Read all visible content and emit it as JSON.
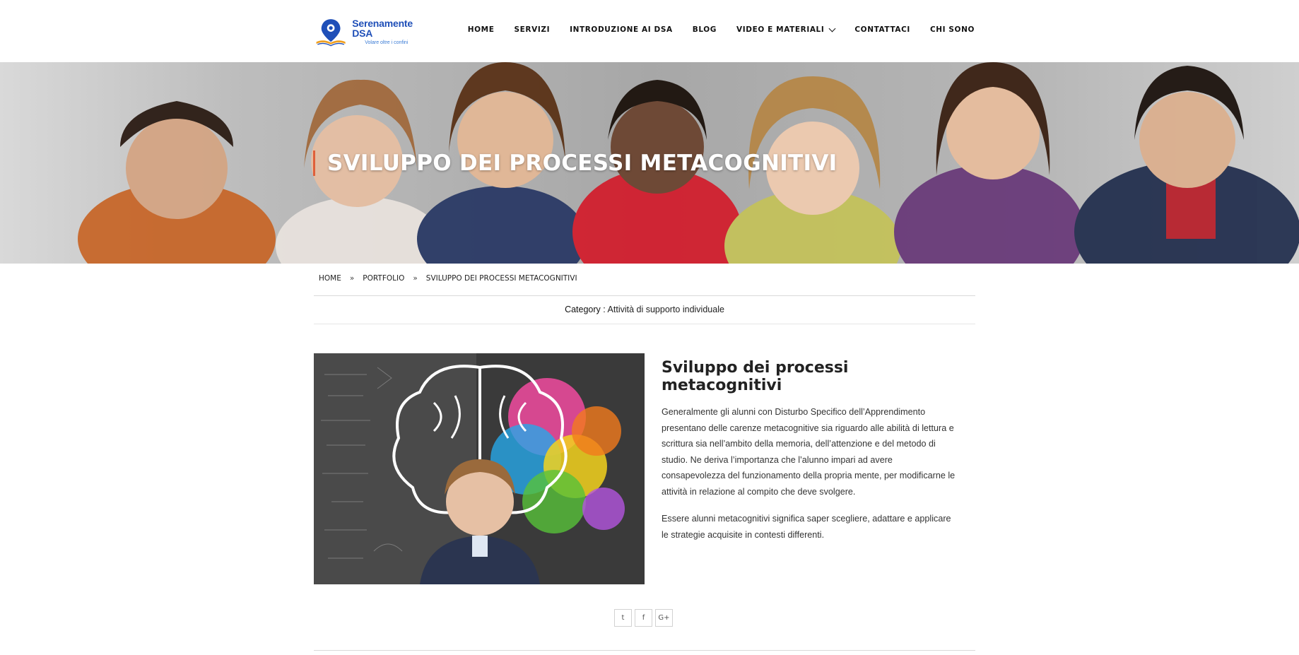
{
  "brand": {
    "name": "Serenamente DSA",
    "tagline": "Volare oltre i confini",
    "colors": {
      "primary": "#1f4fb8",
      "accent": "#e0603a",
      "logo_book_orange": "#f0a020"
    }
  },
  "nav": {
    "items": [
      {
        "label": "HOME"
      },
      {
        "label": "SERVIZI"
      },
      {
        "label": "INTRODUZIONE AI DSA"
      },
      {
        "label": "BLOG"
      },
      {
        "label": "VIDEO E MATERIALI",
        "dropdown": true
      },
      {
        "label": "CONTATTACI"
      },
      {
        "label": "CHI SONO"
      }
    ]
  },
  "hero": {
    "title": "SVILUPPO DEI PROCESSI METACOGNITIVI"
  },
  "breadcrumb": {
    "items": [
      "HOME",
      "PORTFOLIO",
      "SVILUPPO DEI PROCESSI METACOGNITIVI"
    ],
    "separator": "»"
  },
  "category": {
    "label": "Category :",
    "value": "Attività di supporto individuale"
  },
  "article": {
    "title": "Sviluppo dei processi metacognitivi",
    "paragraphs": [
      "Generalmente gli alunni con Disturbo Specifico dell’Apprendimento presentano delle carenze metacognitive sia riguardo alle abilità di lettura e scrittura sia nell’ambito della memoria, dell’attenzione e del metodo di studio. Ne deriva l’importanza che l’alunno impari ad avere consapevolezza del funzionamento della propria mente, per modificarne le attività in relazione al compito che deve svolgere.",
      "Essere alunni metacognitivi significa saper scegliere, adattare e applicare le strategie acquisite in contesti differenti."
    ]
  },
  "share": {
    "buttons": [
      {
        "icon": "twitter-icon",
        "glyph": "t"
      },
      {
        "icon": "facebook-icon",
        "glyph": "f"
      },
      {
        "icon": "google-plus-icon",
        "glyph": "G+"
      }
    ]
  }
}
